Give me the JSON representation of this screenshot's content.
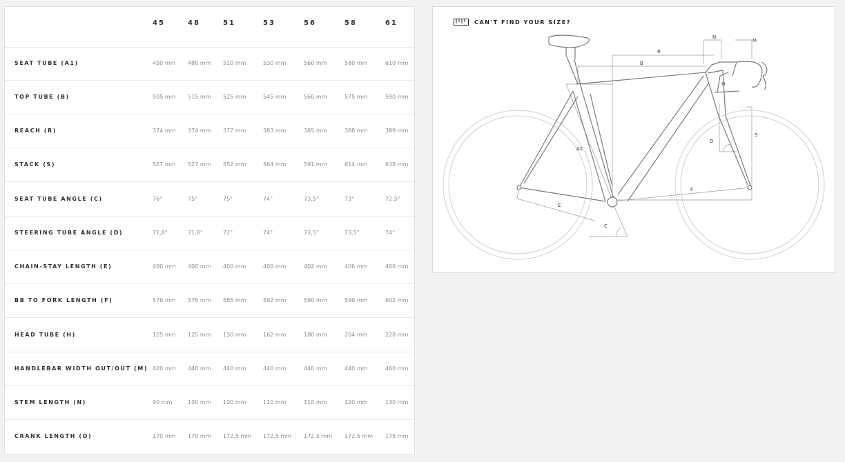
{
  "sizes": [
    "45",
    "48",
    "51",
    "53",
    "56",
    "58",
    "61"
  ],
  "rows": [
    {
      "label": "SEAT TUBE (A1)",
      "values": [
        "450 mm",
        "480 mm",
        "510 mm",
        "530 mm",
        "560 mm",
        "580 mm",
        "610 mm"
      ]
    },
    {
      "label": "TOP TUBE (B)",
      "values": [
        "505 mm",
        "515 mm",
        "525 mm",
        "545 mm",
        "560 mm",
        "575 mm",
        "590 mm"
      ]
    },
    {
      "label": "REACH (R)",
      "values": [
        "374 mm",
        "374 mm",
        "377 mm",
        "383 mm",
        "385 mm",
        "388 mm",
        "389 mm"
      ]
    },
    {
      "label": "STACK (S)",
      "values": [
        "527 mm",
        "527 mm",
        "552 mm",
        "564 mm",
        "591 mm",
        "614 mm",
        "638 mm"
      ]
    },
    {
      "label": "SEAT TUBE ANGLE (C)",
      "values": [
        "76°",
        "75°",
        "75°",
        "74°",
        "73,5°",
        "73°",
        "72,5°"
      ]
    },
    {
      "label": "STEERING TUBE ANGLE (D)",
      "values": [
        "71,8°",
        "71,8°",
        "72°",
        "74°",
        "73,5°",
        "73,5°",
        "74°"
      ]
    },
    {
      "label": "CHAIN-STAY LENGTH (E)",
      "values": [
        "400 mm",
        "400 mm",
        "400 mm",
        "400 mm",
        "402 mm",
        "406 mm",
        "406 mm"
      ]
    },
    {
      "label": "BB TO FORK LENGTH (F)",
      "values": [
        "576 mm",
        "576 mm",
        "585 mm",
        "592 mm",
        "590 mm",
        "599 mm",
        "602 mm"
      ]
    },
    {
      "label": "HEAD TUBE (H)",
      "values": [
        "125 mm",
        "125 mm",
        "150 mm",
        "162 mm",
        "180 mm",
        "204 mm",
        "228 mm"
      ]
    },
    {
      "label": "HANDLEBAR WIDTH OUT/OUT (M)",
      "values": [
        "420 mm",
        "440 mm",
        "440 mm",
        "440 mm",
        "440 mm",
        "440 mm",
        "460 mm"
      ]
    },
    {
      "label": "STEM LENGTH (N)",
      "values": [
        "90 mm",
        "100 mm",
        "100 mm",
        "110 mm",
        "110 mm",
        "120 mm",
        "130 mm"
      ]
    },
    {
      "label": "CRANK LENGTH (O)",
      "values": [
        "170 mm",
        "170 mm",
        "172,5 mm",
        "172,5 mm",
        "172,5 mm",
        "172,5 mm",
        "175 mm"
      ]
    }
  ],
  "diagram": {
    "help_icon": "ruler-icon",
    "help_text": "CAN'T FIND YOUR SIZE?",
    "labels": {
      "n": "N",
      "m": "M",
      "r": "R",
      "b": "B",
      "h": "H",
      "a1": "A1",
      "d": "D",
      "s": "S",
      "f": "F",
      "e": "E",
      "c": "C"
    }
  },
  "colors": {
    "background": "#f2f2f2",
    "panel": "#ffffff",
    "text": "#333333",
    "value": "#8a8a8a",
    "line": "#9a9a9a"
  }
}
